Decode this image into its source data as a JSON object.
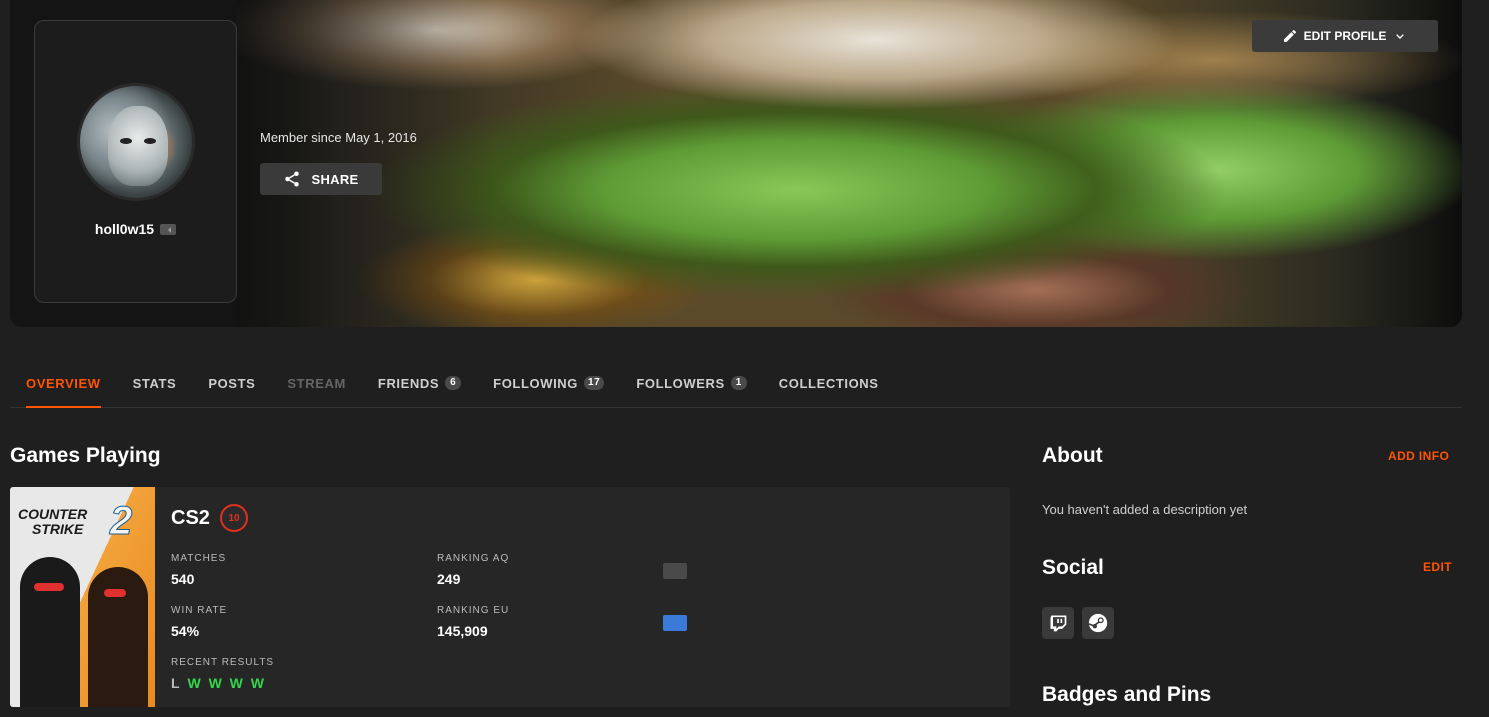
{
  "profile": {
    "username": "holl0w15",
    "member_since": "Member since May 1, 2016",
    "share_label": "SHARE",
    "edit_label": "EDIT PROFILE"
  },
  "tabs": [
    {
      "label": "OVERVIEW",
      "badge": "",
      "state": "active"
    },
    {
      "label": "STATS",
      "badge": "",
      "state": "normal"
    },
    {
      "label": "POSTS",
      "badge": "",
      "state": "normal"
    },
    {
      "label": "STREAM",
      "badge": "",
      "state": "disabled"
    },
    {
      "label": "FRIENDS",
      "badge": "6",
      "state": "normal"
    },
    {
      "label": "FOLLOWING",
      "badge": "17",
      "state": "normal"
    },
    {
      "label": "FOLLOWERS",
      "badge": "1",
      "state": "normal"
    },
    {
      "label": "COLLECTIONS",
      "badge": "",
      "state": "normal"
    }
  ],
  "games": {
    "title": "Games Playing",
    "items": [
      {
        "cover_line1": "COUNTER",
        "cover_line2": "STRIKE",
        "cover_number": "2",
        "name": "CS2",
        "level": "10",
        "matches_label": "MATCHES",
        "matches_value": "540",
        "ranking_aq_label": "RANKING AQ",
        "ranking_aq_value": "249",
        "win_rate_label": "WIN RATE",
        "win_rate_value": "54%",
        "ranking_eu_label": "RANKING EU",
        "ranking_eu_value": "145,909",
        "recent_results_label": "RECENT RESULTS",
        "recent_results": [
          "L",
          "W",
          "W",
          "W",
          "W"
        ]
      }
    ]
  },
  "about": {
    "title": "About",
    "action_label": "ADD INFO",
    "text": "You haven't added a description yet"
  },
  "social": {
    "title": "Social",
    "action_label": "EDIT",
    "icons": [
      "twitch-icon",
      "steam-icon"
    ]
  },
  "badges": {
    "title": "Badges and Pins"
  },
  "colors": {
    "accent": "#ff5500",
    "win": "#32d74b",
    "background": "#1f1f1f",
    "card": "#262626"
  }
}
